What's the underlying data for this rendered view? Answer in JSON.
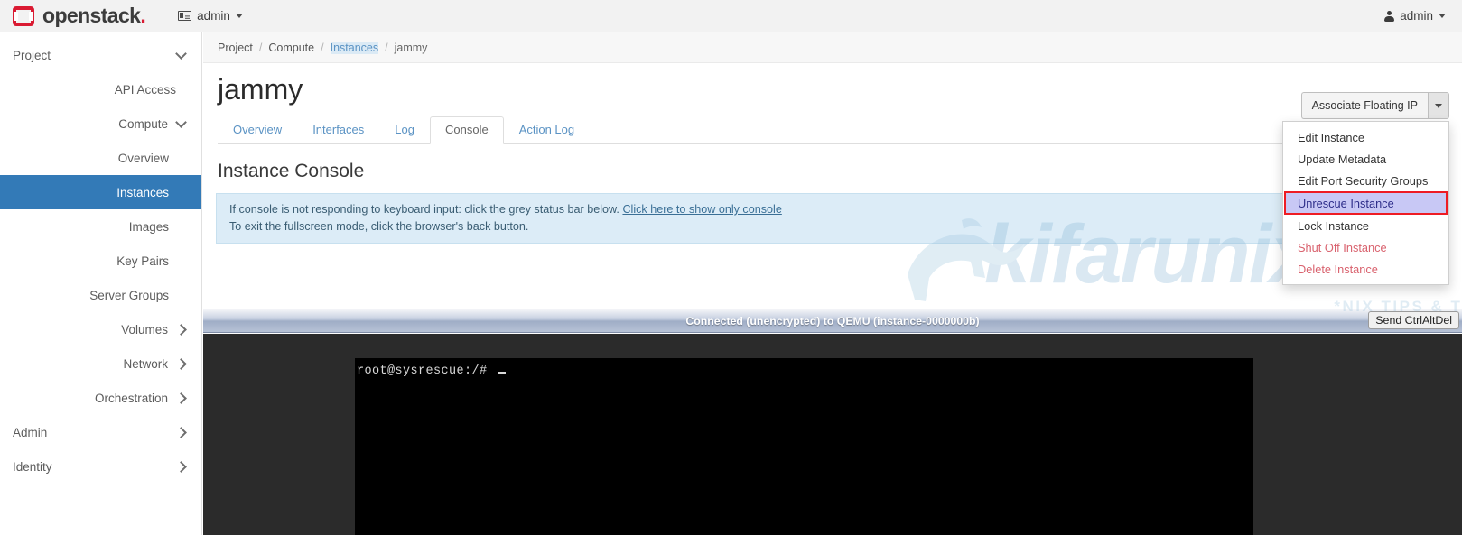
{
  "topbar": {
    "brand_name": "openstack",
    "brand_dot": ".",
    "project_switcher": "admin",
    "project_switcher_icon": "grid-icon",
    "user_name": "admin",
    "user_icon": "user-icon",
    "caret_icon": "chevron-down-icon"
  },
  "sidebar": {
    "items": [
      {
        "label": "Project",
        "level": 0,
        "state": "expanded",
        "icon": "chevron-down-icon"
      },
      {
        "label": "API Access",
        "level": 1,
        "state": "leaf",
        "icon": ""
      },
      {
        "label": "Compute",
        "level": 1,
        "state": "expanded",
        "icon": "chevron-down-icon"
      },
      {
        "label": "Overview",
        "level": 2,
        "state": "leaf",
        "icon": ""
      },
      {
        "label": "Instances",
        "level": 2,
        "state": "active",
        "icon": ""
      },
      {
        "label": "Images",
        "level": 2,
        "state": "leaf",
        "icon": ""
      },
      {
        "label": "Key Pairs",
        "level": 2,
        "state": "leaf",
        "icon": ""
      },
      {
        "label": "Server Groups",
        "level": 2,
        "state": "leaf",
        "icon": ""
      },
      {
        "label": "Volumes",
        "level": 1,
        "state": "collapsed",
        "icon": "chevron-right-icon"
      },
      {
        "label": "Network",
        "level": 1,
        "state": "collapsed",
        "icon": "chevron-right-icon"
      },
      {
        "label": "Orchestration",
        "level": 1,
        "state": "collapsed",
        "icon": "chevron-right-icon"
      },
      {
        "label": "Admin",
        "level": 0,
        "state": "collapsed",
        "icon": "chevron-right-icon"
      },
      {
        "label": "Identity",
        "level": 0,
        "state": "collapsed",
        "icon": "chevron-right-icon"
      }
    ]
  },
  "breadcrumb": {
    "items": [
      {
        "label": "Project",
        "kind": "plain"
      },
      {
        "label": "Compute",
        "kind": "plain"
      },
      {
        "label": "Instances",
        "kind": "link"
      },
      {
        "label": "jammy",
        "kind": "current"
      }
    ],
    "separator": "/"
  },
  "page": {
    "title": "jammy",
    "section_title": "Instance Console"
  },
  "actions": {
    "primary_label": "Associate Floating IP",
    "caret_icon": "caret-down-icon",
    "menu": [
      {
        "label": "Edit Instance",
        "style": "normal"
      },
      {
        "label": "Update Metadata",
        "style": "normal"
      },
      {
        "label": "Edit Port Security Groups",
        "style": "normal"
      },
      {
        "label": "Unrescue Instance",
        "style": "selected"
      },
      {
        "label": "Lock Instance",
        "style": "normal"
      },
      {
        "label": "Shut Off Instance",
        "style": "danger"
      },
      {
        "label": "Delete Instance",
        "style": "danger"
      }
    ]
  },
  "tabs": [
    {
      "label": "Overview",
      "active": false
    },
    {
      "label": "Interfaces",
      "active": false
    },
    {
      "label": "Log",
      "active": false
    },
    {
      "label": "Console",
      "active": true
    },
    {
      "label": "Action Log",
      "active": false
    }
  ],
  "alert": {
    "line1_pre": "If console is not responding to keyboard input: click the grey status bar below. ",
    "line1_link": "Click here to show only console",
    "line2": "To exit the fullscreen mode, click the browser's back button."
  },
  "console": {
    "status_text": "Connected (unencrypted) to QEMU (instance-0000000b)",
    "ctrl_alt_del_label": "Send CtrlAltDel",
    "terminal_line": "root@sysrescue:/# "
  },
  "watermark": {
    "text": "kifarunix",
    "subtitle": "*NIX TIPS & TUTORIALS"
  },
  "colors": {
    "brand_red": "#da1a32",
    "active_blue": "#337ab7",
    "link_blue": "#5b93c4",
    "danger_red": "#d9626e",
    "highlight_outline": "#ee1c24",
    "selection_bg": "#c8c8f5"
  }
}
